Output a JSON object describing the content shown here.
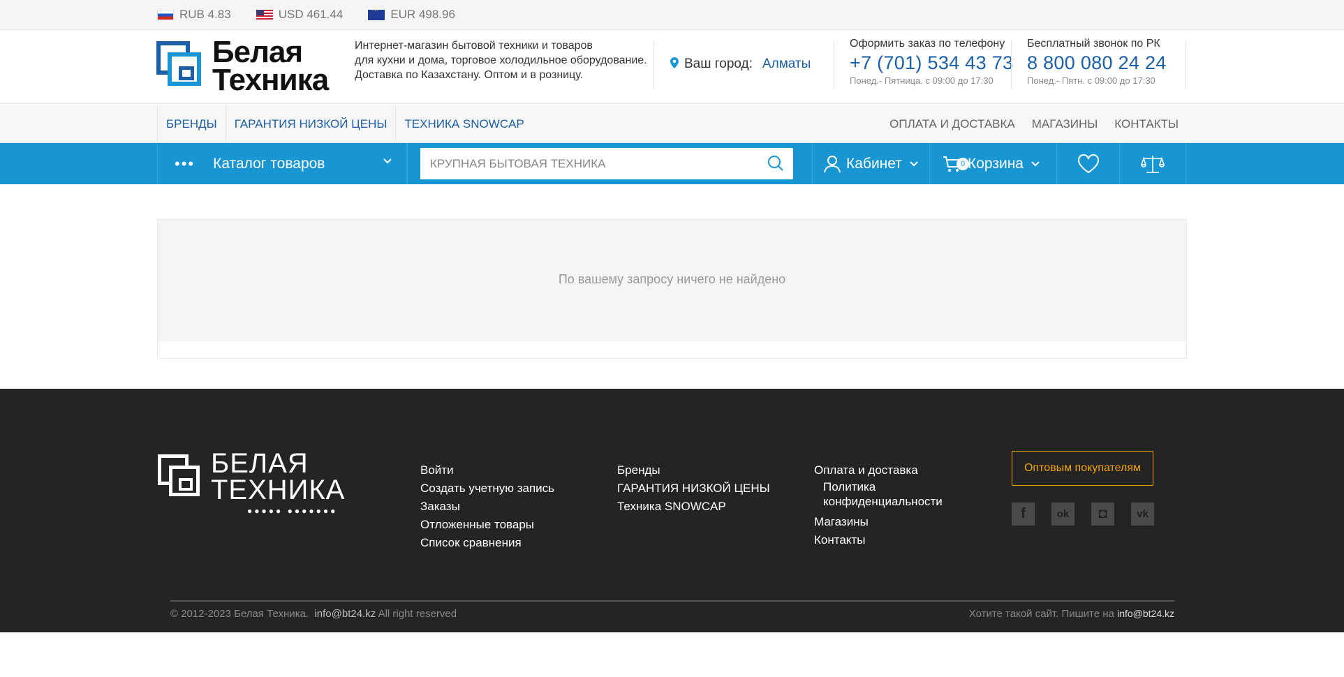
{
  "currencies": [
    {
      "code": "RUB 4.83",
      "flag": "flag-ru"
    },
    {
      "code": "USD 461.44",
      "flag": "flag-us"
    },
    {
      "code": "EUR 498.96",
      "flag": "flag-eu"
    }
  ],
  "header": {
    "logo_line1": "Белая",
    "logo_line2": "Техника",
    "tagline": [
      "Интернет-магазин бытовой техники и товаров",
      "для кухни и дома, торговое холодильное оборудование.",
      "Доставка по Казахстану. Оптом и в розницу."
    ],
    "city_label": "Ваш город:",
    "city_value": "Алматы",
    "phone1": {
      "label": "Оформить заказ по телефону",
      "number": "+7 (701) 534 43 73",
      "hours": "Понед.- Пятница. с 09:00 до 17:30"
    },
    "phone2": {
      "label": "Бесплатный звонок по РК",
      "number": "8 800 080 24 24",
      "hours": "Понед.- Пятн. с 09:00 до 17:30"
    }
  },
  "nav": {
    "left": [
      "Бренды",
      "Гарантия низкой цены",
      "Техника SNOWCAP"
    ],
    "right": [
      "Оплата и доставка",
      "Магазины",
      "Контакты"
    ]
  },
  "toolbar": {
    "catalog_label": "Каталог товаров",
    "search_placeholder": "КРУПНАЯ БЫТОВАЯ ТЕХНИКА",
    "cabinet_label": "Кабинет",
    "cart_label": "Корзина",
    "cart_count": "0"
  },
  "main": {
    "empty_message": "По вашему запросу ничего не найдено"
  },
  "footer": {
    "logo_line1": "БЕЛАЯ",
    "logo_line2": "ТЕХНИКА",
    "logo_dots": "●●●●● ●●●●●●●",
    "col1": [
      "Войти",
      "Создать учетную запись",
      "Заказы",
      "Отложенные товары",
      "Список сравнения"
    ],
    "col2": [
      "Бренды",
      "ГАРАНТИЯ НИЗКОЙ ЦЕНЫ",
      "Техника SNOWCAP"
    ],
    "col3_first": "Оплата и доставка",
    "col3_policy1": "Политика",
    "col3_policy2": "конфиденциальности",
    "col3_rest": [
      "Магазины",
      "Контакты"
    ],
    "wholesale_button": "Оптовым покупателям",
    "socials": [
      {
        "icon": "facebook-icon",
        "glyph": "f"
      },
      {
        "icon": "odnoklassniki-icon",
        "glyph": "ok"
      },
      {
        "icon": "instagram-icon",
        "glyph": "◘"
      },
      {
        "icon": "vk-icon",
        "glyph": "vk"
      }
    ],
    "copyright_prefix": "© 2012-2023 Белая Техника.",
    "copyright_email": "info@bt24.kz",
    "copyright_suffix": "All right reserved",
    "credit_text": "Хотите такой сайт. Пишите на",
    "credit_email": "info@bt24.kz"
  },
  "colors": {
    "brand_blue": "#1a5fa8",
    "bar_blue": "#1896d4",
    "accent_orange": "#f0a30a",
    "footer_bg": "#242424"
  }
}
